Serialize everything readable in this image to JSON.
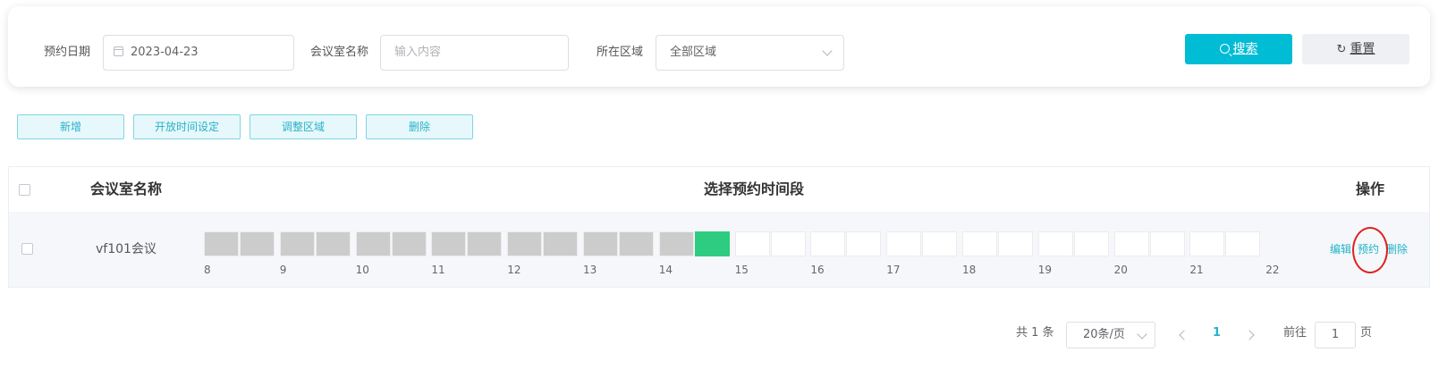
{
  "search": {
    "date_label": "预约日期",
    "date_value": "2023-04-23",
    "room_label": "会议室名称",
    "room_placeholder": "输入内容",
    "area_label": "所在区域",
    "area_value": "全部区域",
    "search_button": "搜索",
    "reset_button": "重置",
    "search_icon": "search-icon",
    "reset_icon": "refresh-icon"
  },
  "toolbar": {
    "add": "新增",
    "open_time": "开放时间设定",
    "adjust_area": "调整区域",
    "delete": "删除"
  },
  "table": {
    "col_name": "会议室名称",
    "col_timeslot": "选择预约时间段",
    "col_ops": "操作",
    "rows": [
      {
        "name": "vf101会议",
        "hours": [
          "8",
          "9",
          "10",
          "11",
          "12",
          "13",
          "14",
          "15",
          "16",
          "17",
          "18",
          "19",
          "20",
          "21",
          "22"
        ],
        "slots": [
          "booked",
          "booked",
          "booked",
          "booked",
          "booked",
          "booked",
          "booked",
          "booked",
          "booked",
          "booked",
          "booked",
          "booked",
          "booked",
          "selected",
          "free",
          "free",
          "free",
          "free",
          "free",
          "free",
          "free",
          "free",
          "free",
          "free",
          "free",
          "free",
          "free",
          "free"
        ],
        "ops": {
          "edit": "编辑",
          "reserve": "预约",
          "delete": "删除"
        }
      }
    ]
  },
  "colors": {
    "accent": "#00bcd4",
    "booked": "#cccccc",
    "selected": "#2ecc80",
    "free": "#ffffff",
    "highlight_circle": "#e02020"
  },
  "pagination": {
    "total": "共 1 条",
    "page_size": "20条/页",
    "current_page": "1",
    "goto_prefix": "前往",
    "goto_value": "1",
    "goto_suffix": "页"
  }
}
